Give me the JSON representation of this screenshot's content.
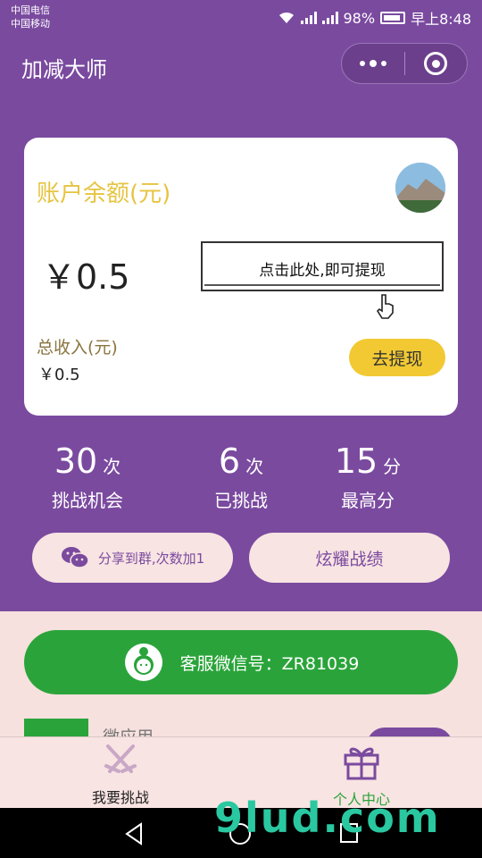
{
  "status_bar": {
    "carrier_1": "中国电信",
    "carrier_2": "中国移动",
    "battery": "98%",
    "time": "早上8:48"
  },
  "header": {
    "title": "加减大师"
  },
  "account": {
    "balance_title": "账户余额(元)",
    "balance_value": "￥0.5",
    "tip_text": "点击此处,即可提现",
    "total_income_label": "总收入(元)",
    "total_income_value": "￥0.5",
    "withdraw_button": "去提现"
  },
  "stats": [
    {
      "value": "30",
      "unit": "次",
      "label": "挑战机会"
    },
    {
      "value": "6",
      "unit": "次",
      "label": "已挑战"
    },
    {
      "value": "15",
      "unit": "分",
      "label": "最高分"
    }
  ],
  "actions": {
    "share_label": "分享到群,次数加1",
    "show_label": "炫耀战绩"
  },
  "service": {
    "label": "客服微信号：ZR81039"
  },
  "mini_app": {
    "name": "微应用"
  },
  "tabbar": {
    "tab_challenge": "我要挑战",
    "tab_profile": "个人中心"
  },
  "watermark": {
    "text": "9lud.com"
  },
  "colors": {
    "primary": "#7a4a9f",
    "accent_yellow": "#f2c933",
    "green": "#2aa43a",
    "active_tab": "#2aa43a"
  }
}
